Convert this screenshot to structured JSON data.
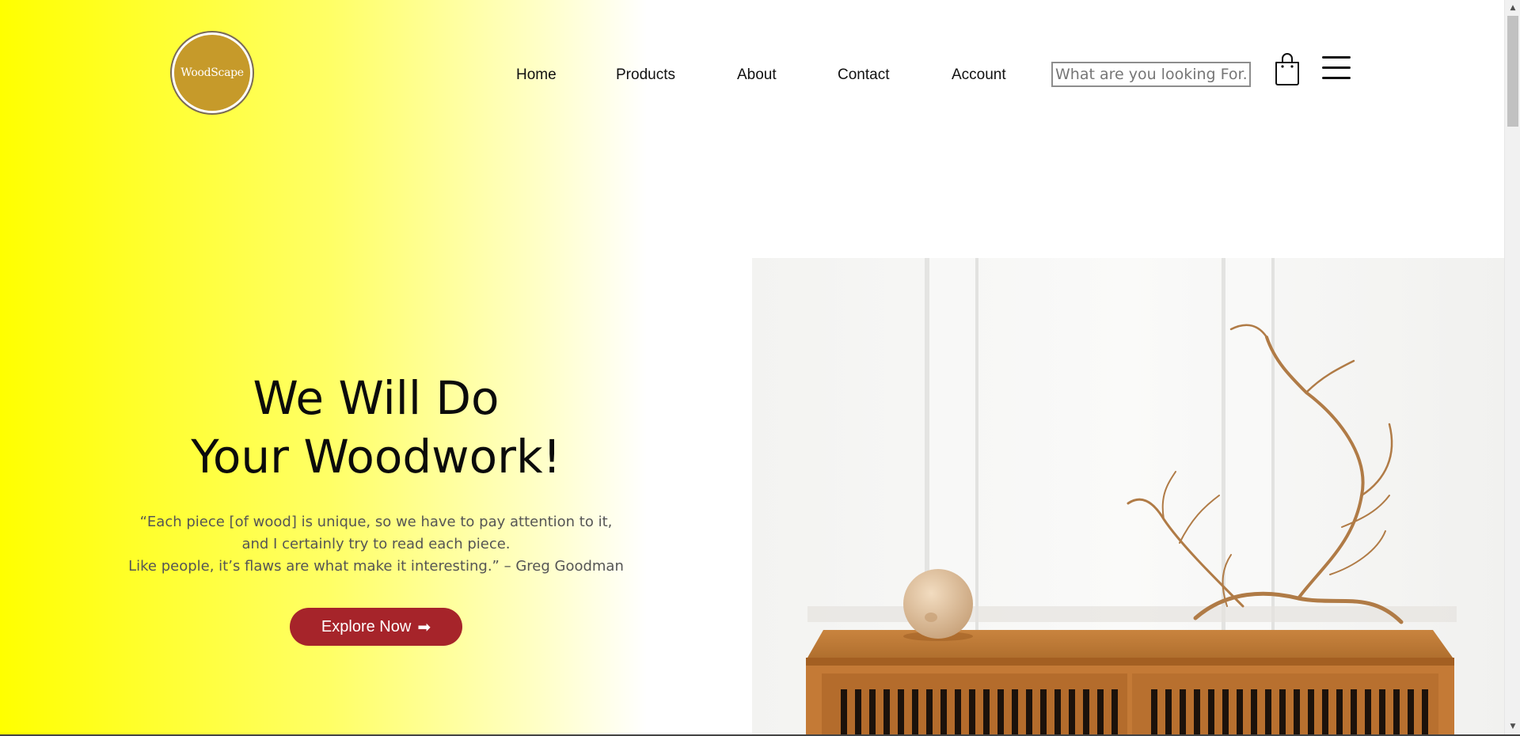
{
  "brand": {
    "logo_text": "WoodScape"
  },
  "nav": {
    "items": [
      "Home",
      "Products",
      "About",
      "Contact",
      "Account"
    ]
  },
  "search": {
    "placeholder": "What are you looking For.."
  },
  "hero": {
    "title_line1": "We Will Do",
    "title_line2": "Your Woodwork!",
    "quote_line1": "“Each piece [of wood] is unique, so we have to pay attention to it,",
    "quote_line2": "and I certainly try to read each piece.",
    "quote_line3": "Like people, it’s flaws are what make it interesting.” – Greg Goodman",
    "cta_label": "Explore Now",
    "cta_arrow": "➡"
  },
  "icons": [
    "shopping-bag-icon",
    "hamburger-menu-icon",
    "scroll-up-icon",
    "scroll-down-icon"
  ],
  "colors": {
    "gradient_start": "#ffff00",
    "cta_background": "#a6242a",
    "logo_gold": "#c69a2a"
  }
}
